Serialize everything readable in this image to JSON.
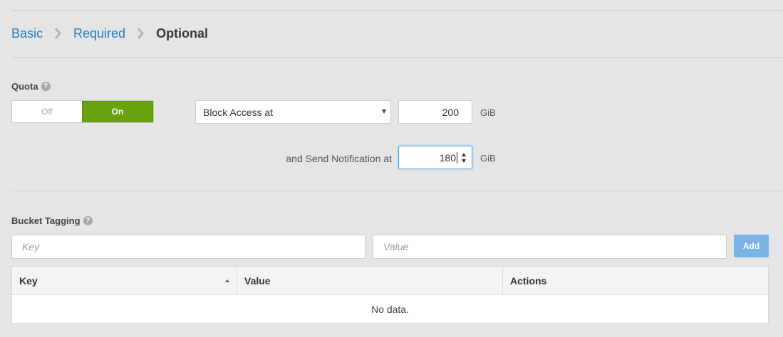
{
  "breadcrumb": {
    "items": [
      {
        "label": "Basic"
      },
      {
        "label": "Required"
      },
      {
        "label": "Optional"
      }
    ]
  },
  "quota": {
    "label": "Quota",
    "help_icon": "question-circle-icon",
    "toggle": {
      "off_label": "Off",
      "on_label": "On",
      "state": "On",
      "on_color": "#6aa311"
    },
    "mode_select": {
      "value": "Block Access at"
    },
    "block_value": "200",
    "block_unit": "GiB",
    "notify_label": "and Send Notification at",
    "notify_value": "180",
    "notify_unit": "GiB"
  },
  "tagging": {
    "label": "Bucket Tagging",
    "help_icon": "question-circle-icon",
    "key_placeholder": "Key",
    "value_placeholder": "Value",
    "add_label": "Add",
    "add_color": "#7cb3e4",
    "table": {
      "columns": [
        {
          "label": "Key",
          "sorted": "ascending"
        },
        {
          "label": "Value"
        },
        {
          "label": "Actions"
        }
      ],
      "empty_text": "No data."
    }
  },
  "colors": {
    "link": "#1f7bbf",
    "background": "#e5e5e5",
    "focus_border": "#66a4e0"
  }
}
